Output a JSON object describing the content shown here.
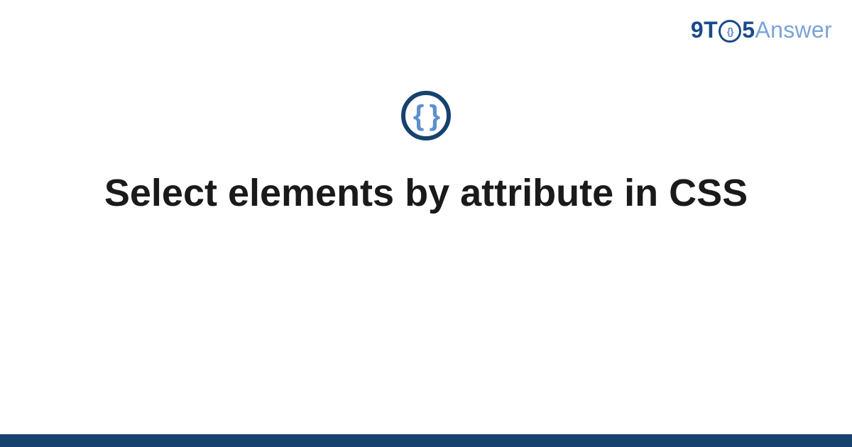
{
  "logo": {
    "part_9t": "9T",
    "clock_inner": "{}",
    "part_5": "5",
    "part_answer": "Answer"
  },
  "icon": {
    "braces": "{ }"
  },
  "title": "Select elements by attribute in CSS"
}
